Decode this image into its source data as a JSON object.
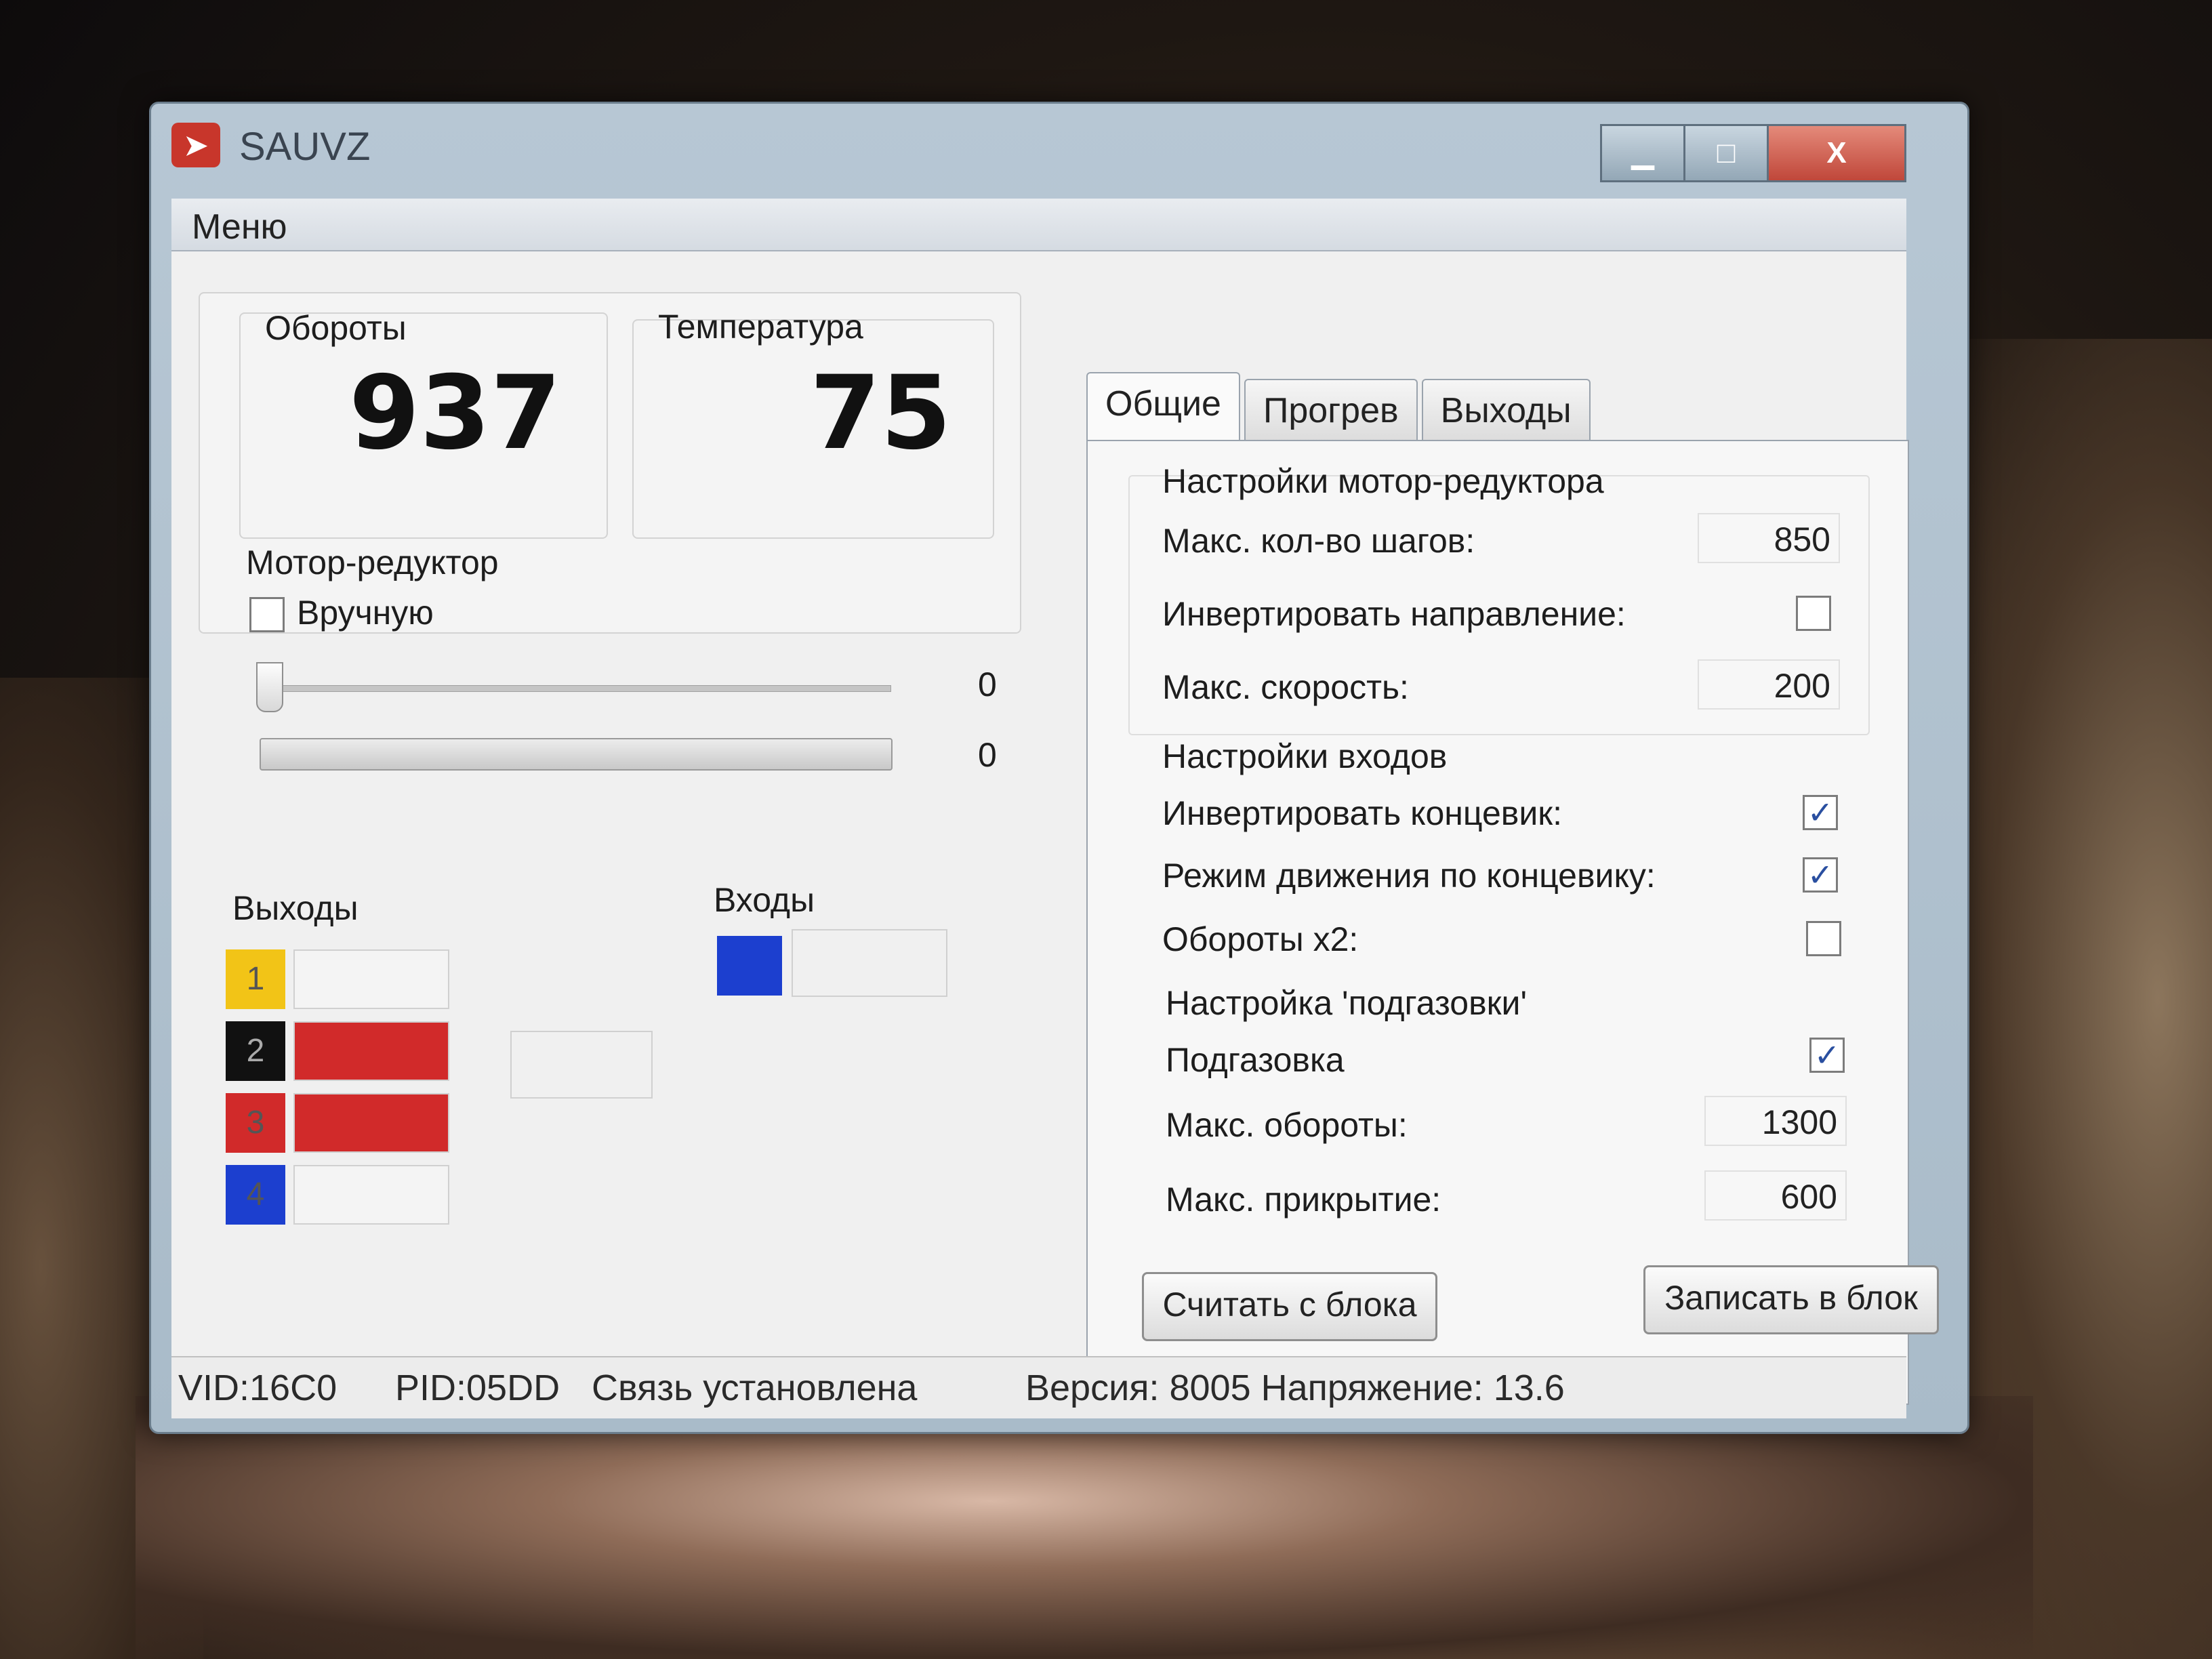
{
  "window": {
    "title": "SAUVZ",
    "icon": "app-logo-icon",
    "controls": {
      "minimize": "▁",
      "maximize": "□",
      "close": "X"
    }
  },
  "menu": {
    "item": "Меню"
  },
  "rpm": {
    "label": "Обороты",
    "value": "937"
  },
  "temperature": {
    "label": "Температура",
    "value": "75"
  },
  "motor": {
    "label": "Мотор-редуктор",
    "manual_label": "Вручную",
    "manual_checked": false,
    "slider_value": "0",
    "progress_value": "0"
  },
  "outputs": {
    "label": "Выходы",
    "items": [
      {
        "num": "1",
        "color": "#f2c417",
        "state_color": "#f4f4f4"
      },
      {
        "num": "2",
        "color": "#111111",
        "state_color": "#d12a2a"
      },
      {
        "num": "3",
        "color": "#d12a2a",
        "state_color": "#d12a2a"
      },
      {
        "num": "4",
        "color": "#1c3fcf",
        "state_color": "#f4f4f4"
      }
    ]
  },
  "inputs": {
    "label": "Входы",
    "indicator_color": "#1c3fcf"
  },
  "tabs": [
    {
      "label": "Общие",
      "active": true
    },
    {
      "label": "Прогрев",
      "active": false
    },
    {
      "label": "Выходы",
      "active": false
    }
  ],
  "settings": {
    "motor_group": "Настройки мотор-редуктора",
    "max_steps_label": "Макс. кол-во шагов:",
    "max_steps_value": "850",
    "invert_direction_label": "Инвертировать направление:",
    "invert_direction_checked": false,
    "max_speed_label": "Макс. скорость:",
    "max_speed_value": "200",
    "inputs_group": "Настройки  входов",
    "invert_endstop_label": "Инвертировать концевик:",
    "invert_endstop_checked": true,
    "endstop_mode_label": "Режим движения по концевику:",
    "endstop_mode_checked": true,
    "rpm_x2_label": "Обороты x2:",
    "rpm_x2_checked": false,
    "throttle_group": "Настройка 'подгазовки'",
    "throttle_label": "Подгазовка",
    "throttle_checked": true,
    "max_rpm_label": "Макс. обороты:",
    "max_rpm_value": "1300",
    "max_close_label": "Макс. прикрытие:",
    "max_close_value": "600",
    "read_button": "Считать с блока",
    "write_button": "Записать в блок"
  },
  "status": {
    "vid": "VID:16C0",
    "pid": "PID:05DD",
    "connection": "Связь установлена",
    "version": "Версия: 8005 Напряжение: 13.6"
  }
}
